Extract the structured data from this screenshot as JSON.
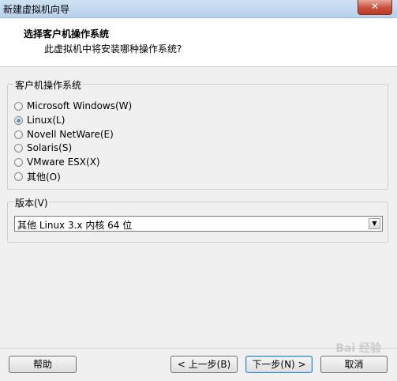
{
  "window": {
    "title": "新建虚拟机向导",
    "close_label": "✕"
  },
  "header": {
    "title": "选择客户机操作系统",
    "subtitle": "此虚拟机中将安装哪种操作系统?"
  },
  "guest_os_group": {
    "label": "客户机操作系统",
    "options": [
      {
        "label": "Microsoft Windows(W)",
        "checked": false
      },
      {
        "label": "Linux(L)",
        "checked": true
      },
      {
        "label": "Novell NetWare(E)",
        "checked": false
      },
      {
        "label": "Solaris(S)",
        "checked": false
      },
      {
        "label": "VMware ESX(X)",
        "checked": false
      },
      {
        "label": "其他(O)",
        "checked": false
      }
    ]
  },
  "version_group": {
    "label": "版本(V)",
    "selected": "其他 Linux 3.x 内核 64 位"
  },
  "buttons": {
    "help": "帮助",
    "back": "< 上一步(B)",
    "next": "下一步(N) >",
    "cancel": "取消"
  },
  "watermark": "Bai 经验"
}
